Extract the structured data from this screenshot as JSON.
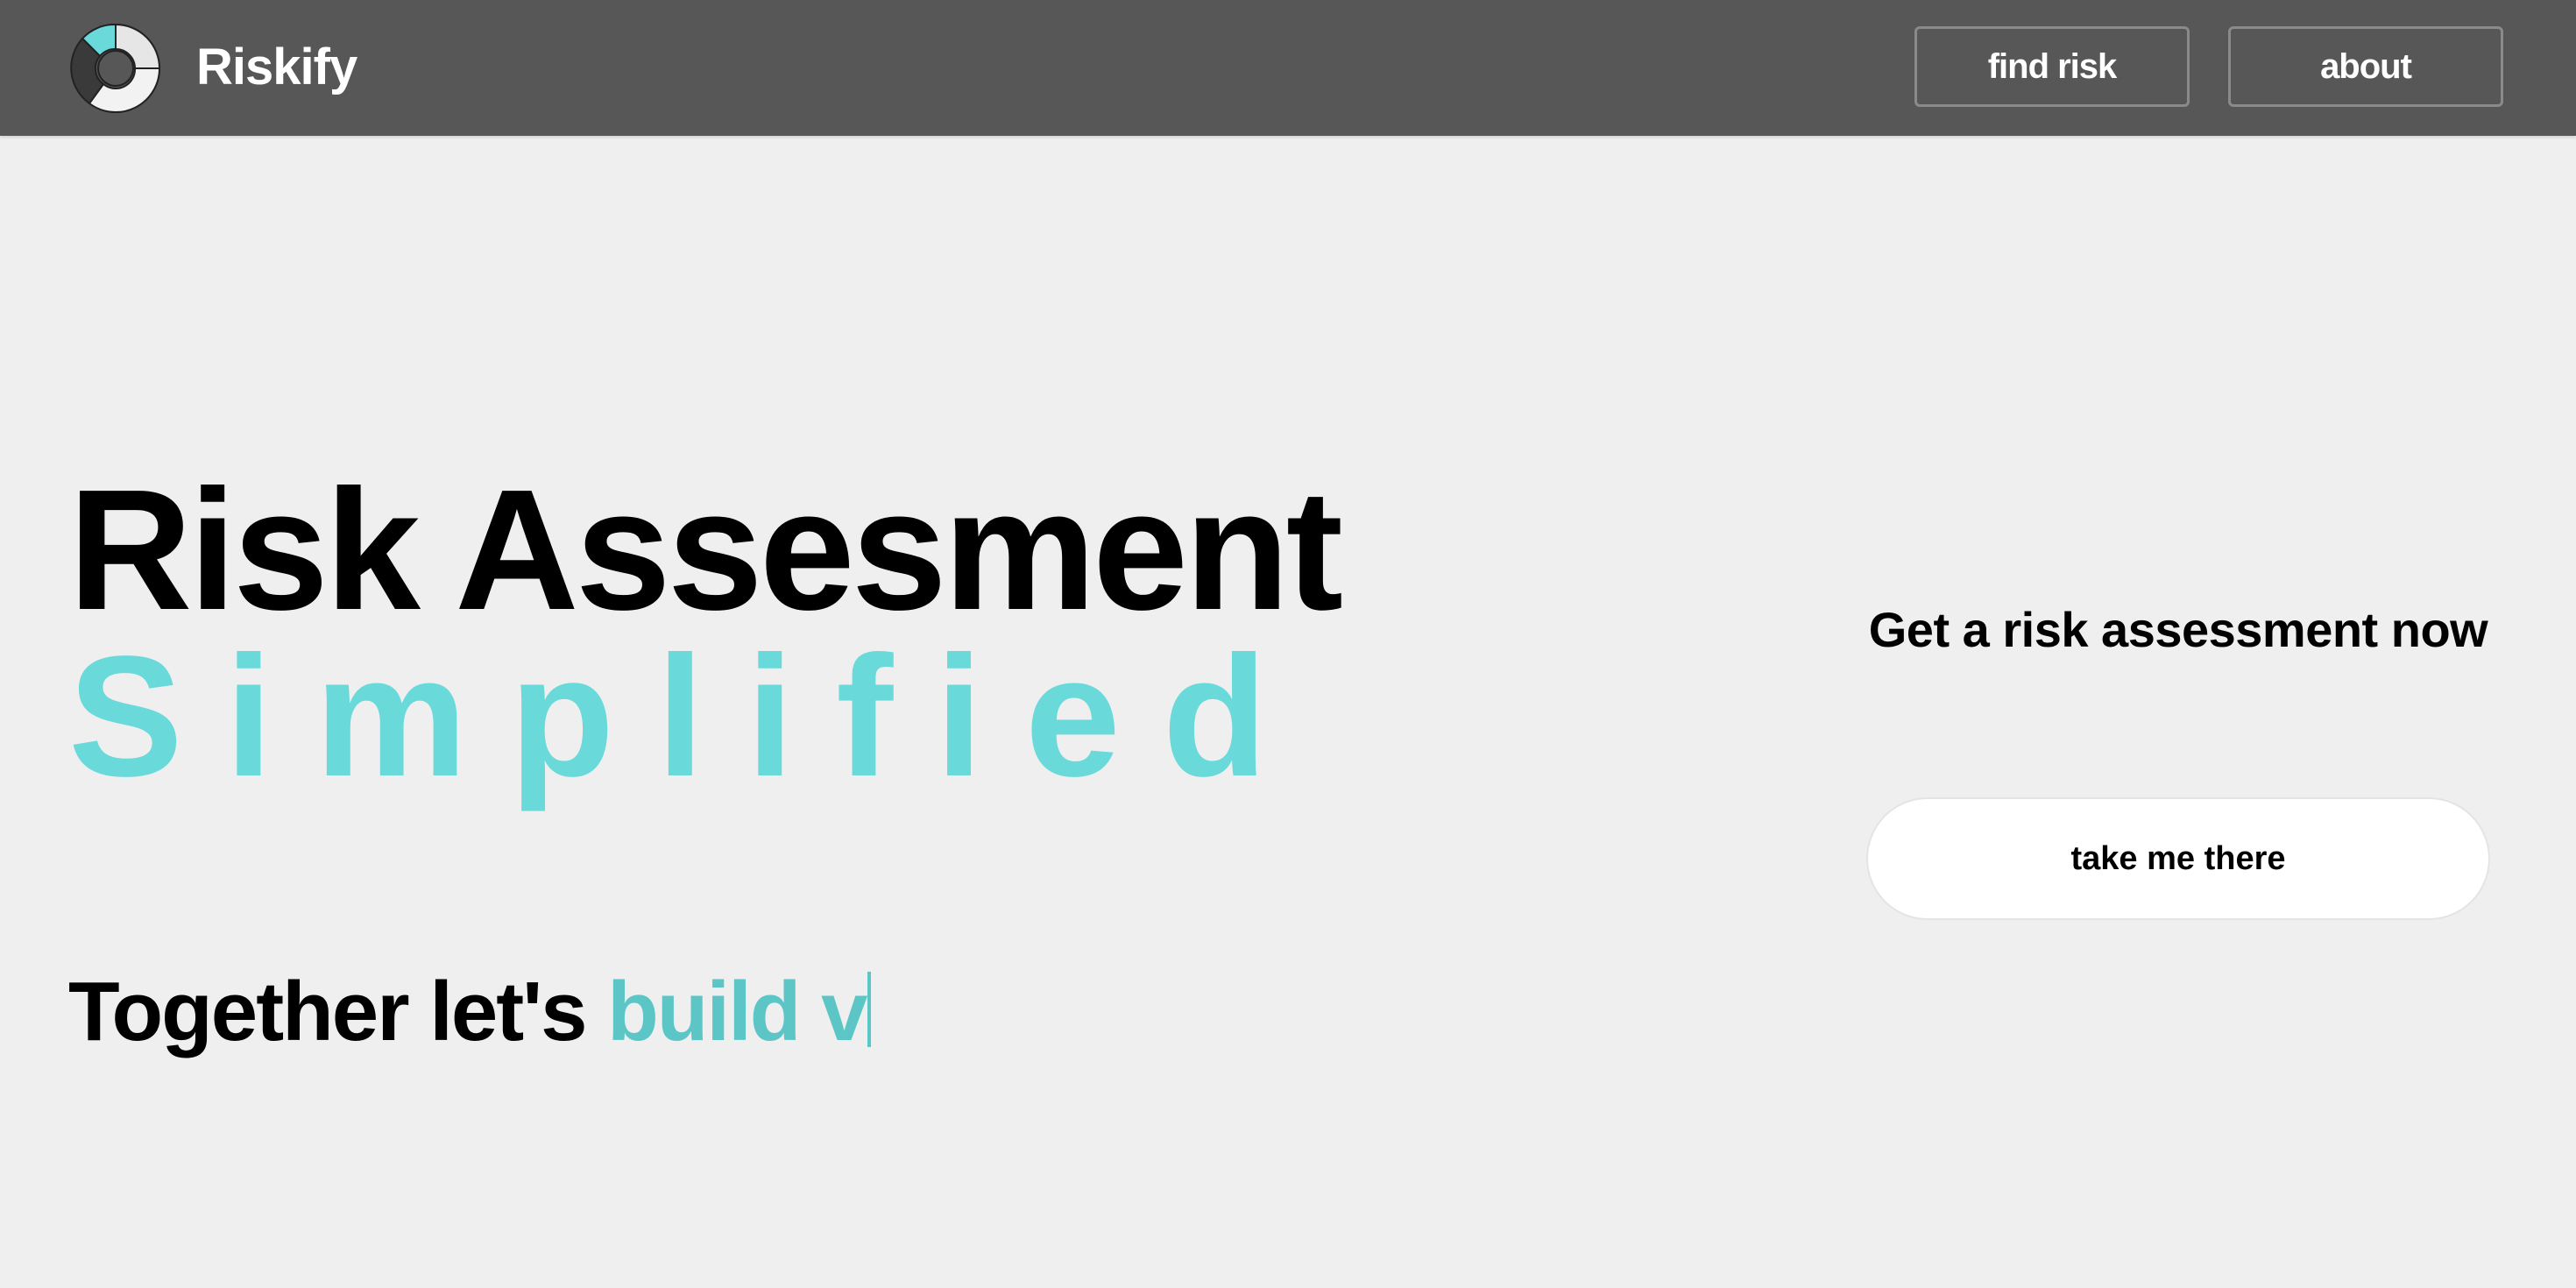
{
  "header": {
    "brand": "Riskify",
    "logo_icon": "riskify-logo-icon",
    "nav": {
      "find_risk_label": "find risk",
      "about_label": "about"
    }
  },
  "hero": {
    "title": "Risk Assesment",
    "subtitle": "Simplified",
    "tagline_static": "Together let's",
    "tagline_typed": "build v"
  },
  "cta": {
    "heading": "Get a risk assessment now",
    "button_label": "take me there"
  },
  "colors": {
    "header_bg": "#575757",
    "page_bg": "#efefef",
    "accent": "#6ad9da",
    "typed_accent": "#5cc6c6"
  }
}
